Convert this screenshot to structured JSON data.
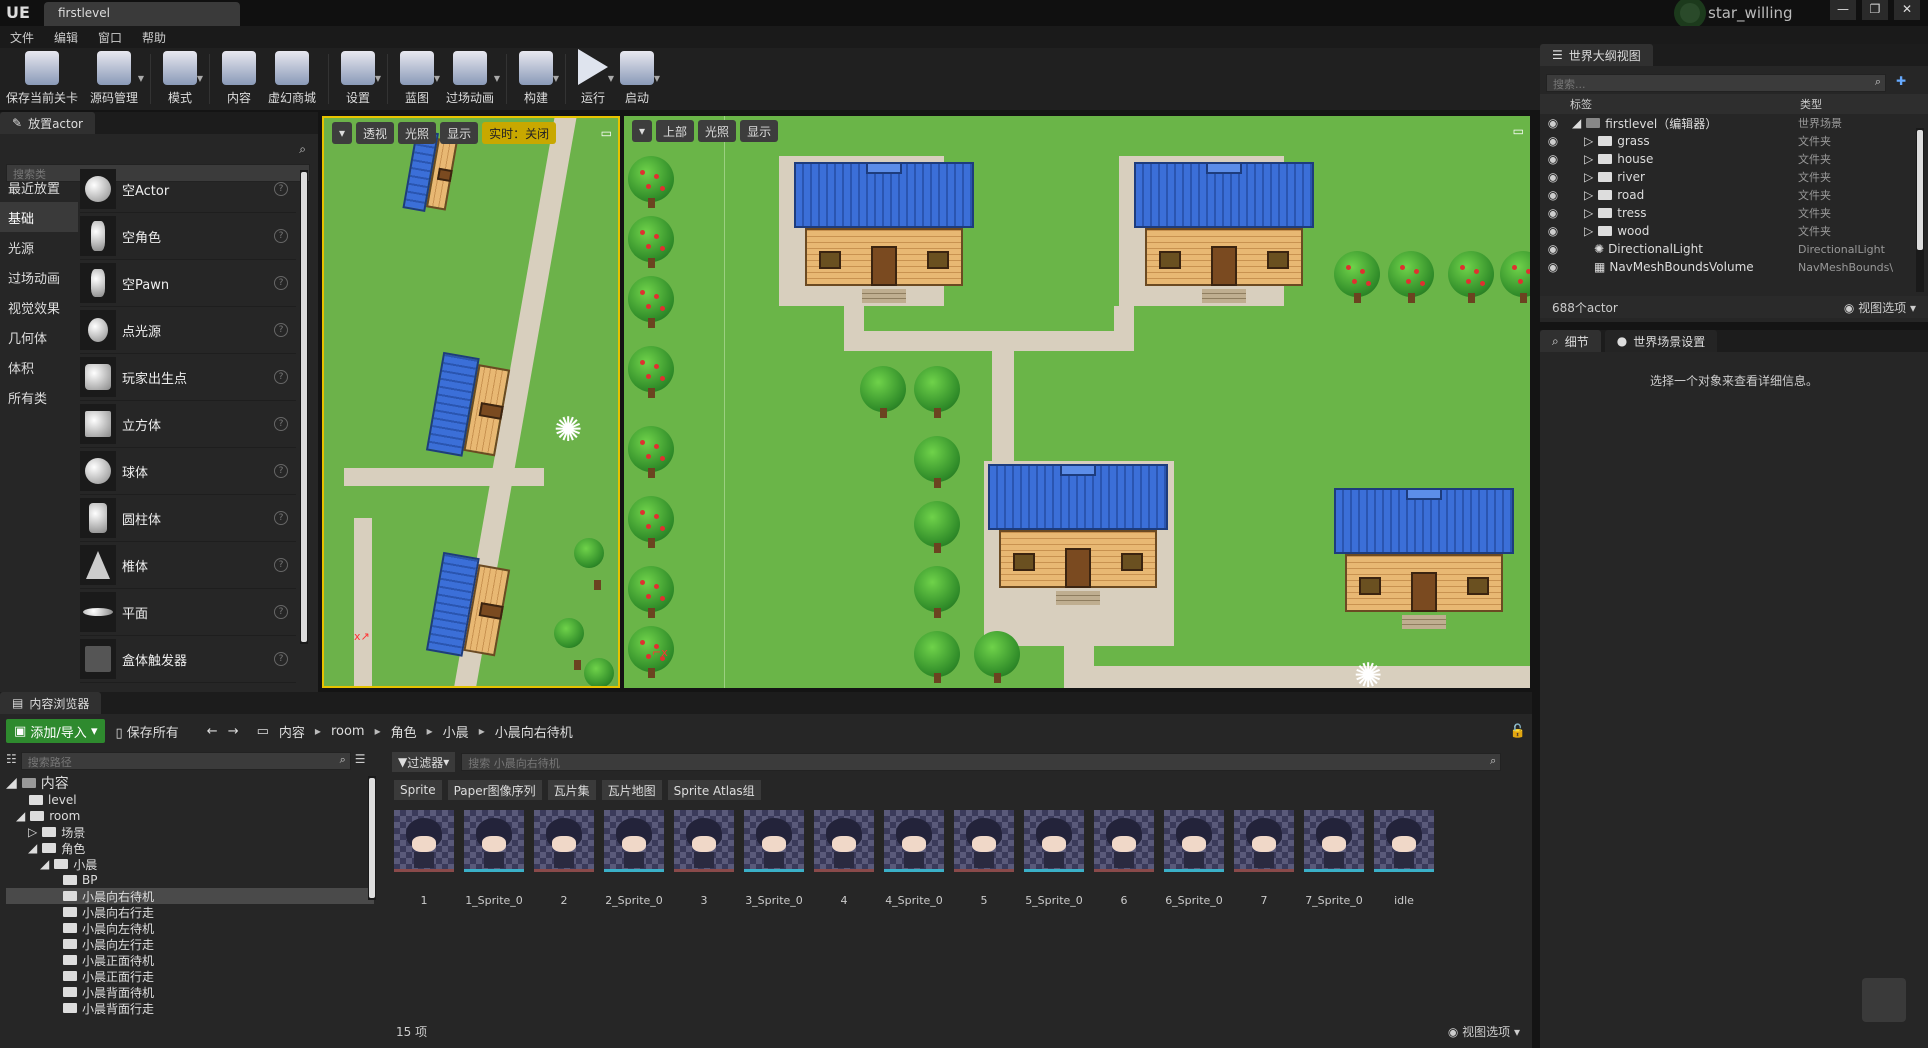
{
  "title_bar": {
    "level_tab": "firstlevel",
    "user": "star_willing",
    "logo": "UE",
    "window_buttons": [
      "—",
      "❐",
      "✕"
    ]
  },
  "menu": [
    "文件",
    "编辑",
    "窗口",
    "帮助"
  ],
  "toolbar": [
    {
      "label": "保存当前关卡",
      "icon": "save-icon"
    },
    {
      "label": "源码管理",
      "icon": "source-control-icon"
    },
    {
      "label": "模式",
      "icon": "modes-icon"
    },
    {
      "label": "内容",
      "icon": "content-icon"
    },
    {
      "label": "虚幻商城",
      "icon": "marketplace-icon"
    },
    {
      "label": "设置",
      "icon": "settings-icon"
    },
    {
      "label": "蓝图",
      "icon": "blueprint-icon"
    },
    {
      "label": "过场动画",
      "icon": "cinematics-icon"
    },
    {
      "label": "构建",
      "icon": "build-icon"
    },
    {
      "label": "运行",
      "icon": "play-icon"
    },
    {
      "label": "启动",
      "icon": "launch-icon"
    }
  ],
  "place_actors": {
    "tab": "放置actor",
    "search_placeholder": "搜索类",
    "categories": [
      "最近放置",
      "基础",
      "光源",
      "过场动画",
      "视觉效果",
      "几何体",
      "体积",
      "所有类"
    ],
    "selected_category": "基础",
    "items": [
      "空Actor",
      "空角色",
      "空Pawn",
      "点光源",
      "玩家出生点",
      "立方体",
      "球体",
      "圆柱体",
      "椎体",
      "平面",
      "盒体触发器"
    ]
  },
  "viewport_left": {
    "buttons": [
      "透视",
      "光照",
      "显示",
      "实时：关闭"
    ]
  },
  "viewport_right": {
    "buttons": [
      "上部",
      "光照",
      "显示"
    ]
  },
  "outliner": {
    "tab": "世界大纲视图",
    "search_placeholder": "搜索...",
    "col_label": "标签",
    "col_type": "类型",
    "rows": [
      {
        "label": "firstlevel（编辑器）",
        "type": "世界场景"
      },
      {
        "label": "grass",
        "type": "文件夹"
      },
      {
        "label": "house",
        "type": "文件夹"
      },
      {
        "label": "river",
        "type": "文件夹"
      },
      {
        "label": "road",
        "type": "文件夹"
      },
      {
        "label": "tress",
        "type": "文件夹"
      },
      {
        "label": "wood",
        "type": "文件夹"
      },
      {
        "label": "DirectionalLight",
        "type": "DirectionalLight"
      },
      {
        "label": "NavMeshBoundsVolume",
        "type": "NavMeshBounds\\"
      }
    ],
    "count": "688个actor",
    "view_options": "视图选项"
  },
  "details": {
    "tab1": "细节",
    "tab2": "世界场景设置",
    "empty_msg": "选择一个对象来查看详细信息。"
  },
  "content_browser": {
    "tab": "内容浏览器",
    "add_import": "添加/导入",
    "save_all": "保存所有",
    "breadcrumb": [
      "内容",
      "room",
      "角色",
      "小晨",
      "小晨向右待机"
    ],
    "path_search_placeholder": "搜索路径",
    "filter_label": "过滤器",
    "asset_search_placeholder": "搜索 小晨向右待机",
    "filter_pills": [
      "Sprite",
      "Paper图像序列",
      "瓦片集",
      "瓦片地图",
      "Sprite Atlas组"
    ],
    "tree": [
      {
        "label": "内容",
        "depth": 0
      },
      {
        "label": "level",
        "depth": 1
      },
      {
        "label": "room",
        "depth": 1
      },
      {
        "label": "场景",
        "depth": 2
      },
      {
        "label": "角色",
        "depth": 2
      },
      {
        "label": "小晨",
        "depth": 3
      },
      {
        "label": "BP",
        "depth": 4
      },
      {
        "label": "小晨向右待机",
        "depth": 4,
        "selected": true
      },
      {
        "label": "小晨向右行走",
        "depth": 4
      },
      {
        "label": "小晨向左待机",
        "depth": 4
      },
      {
        "label": "小晨向左行走",
        "depth": 4
      },
      {
        "label": "小晨正面待机",
        "depth": 4
      },
      {
        "label": "小晨正面行走",
        "depth": 4
      },
      {
        "label": "小晨背面待机",
        "depth": 4
      },
      {
        "label": "小晨背面行走",
        "depth": 4
      }
    ],
    "assets": [
      "1",
      "1_Sprite_0",
      "2",
      "2_Sprite_0",
      "3",
      "3_Sprite_0",
      "4",
      "4_Sprite_0",
      "5",
      "5_Sprite_0",
      "6",
      "6_Sprite_0",
      "7",
      "7_Sprite_0",
      "idle"
    ],
    "count": "15 项",
    "view_options": "视图选项"
  }
}
